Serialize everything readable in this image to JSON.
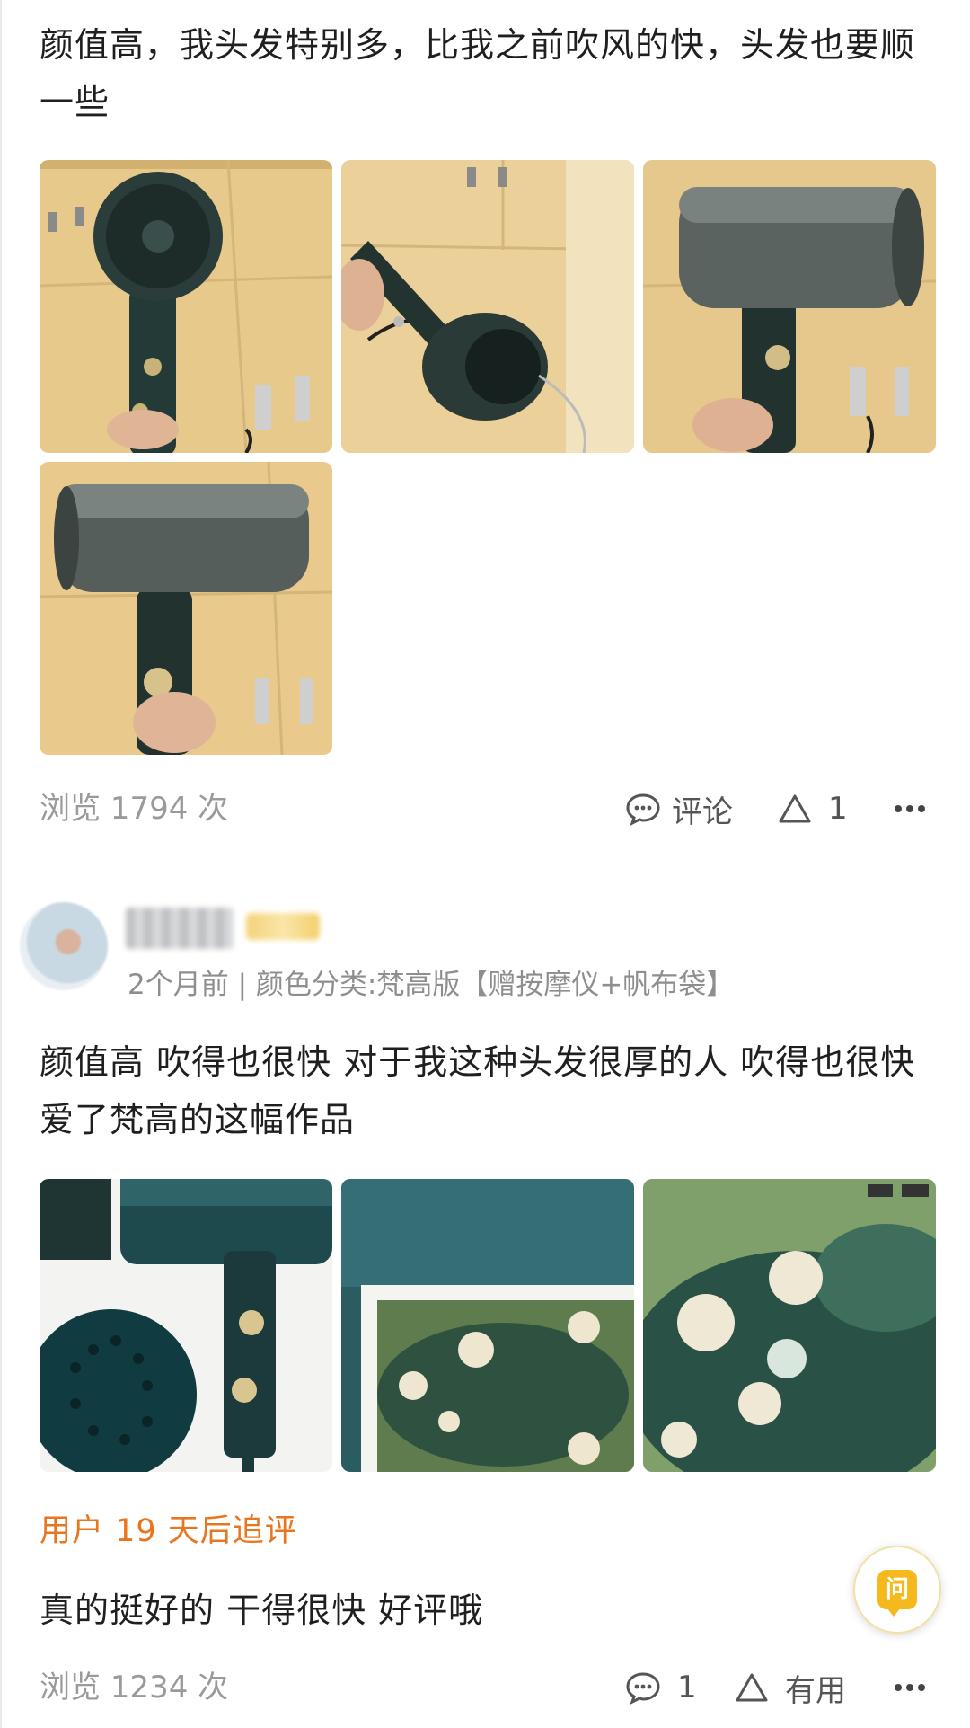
{
  "review1": {
    "text": "颜值高，我头发特别多，比我之前吹风的快，头发也要顺一些",
    "footer": {
      "views": "浏览 1794 次",
      "comment_label": "评论",
      "like_count": "1"
    }
  },
  "review2": {
    "meta": "2个月前 | 颜色分类:梵高版【赠按摩仪+帆布袋】",
    "text": "颜值高 吹得也很快 对于我这种头发很厚的人 吹得也很快 爱了梵高的这幅作品",
    "followup_title": "用户 19 天后追评",
    "followup_text": "真的挺好的  干得很快 好评哦",
    "footer": {
      "views": "浏览 1234 次",
      "comment_count": "1",
      "useful_label": "有用"
    }
  },
  "floating_button": {
    "label": "问"
  },
  "colors": {
    "accent_orange": "#e8761e",
    "ask_yellow": "#f5b91e",
    "muted_gray": "#9a9a9a"
  }
}
